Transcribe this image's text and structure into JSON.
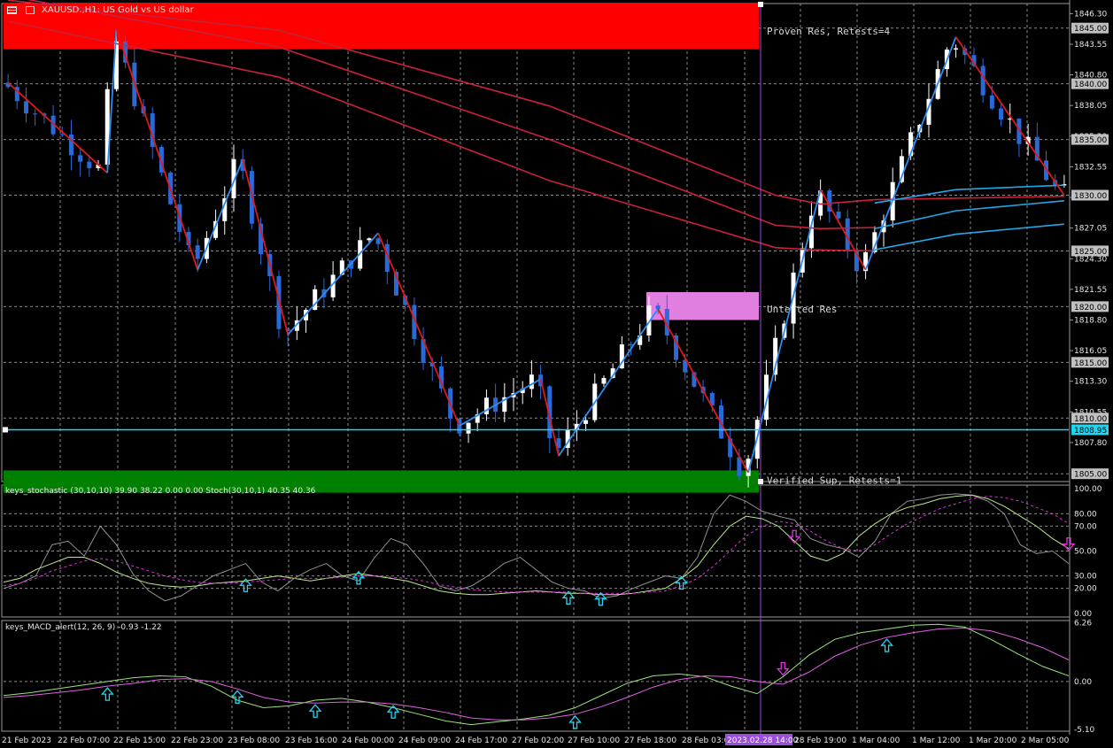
{
  "header": {
    "symbol_title": "XAUUSD.,H1: US Gold vs US dollar"
  },
  "chart_data": [
    {
      "type": "candlestick",
      "title": "XAUUSD.,H1: US Gold vs US dollar",
      "ylim": [
        1804.3,
        1847.2
      ],
      "y_ticks": [
        "1846.30",
        "1843.55",
        "1840.80",
        "1838.05",
        "1835.30",
        "1832.55",
        "1829.80",
        "1827.05",
        "1824.30",
        "1821.55",
        "1818.80",
        "1816.05",
        "1813.30",
        "1810.55",
        "1807.80"
      ],
      "price_tags": [
        {
          "label": "1845.00",
          "value": 1845.0,
          "color": "#c0c0c0"
        },
        {
          "label": "1840.00",
          "value": 1840.0,
          "color": "#c0c0c0"
        },
        {
          "label": "1835.00",
          "value": 1835.0,
          "color": "#c0c0c0"
        },
        {
          "label": "1830.00",
          "value": 1830.0,
          "color": "#c0c0c0"
        },
        {
          "label": "1825.00",
          "value": 1825.0,
          "color": "#c0c0c0"
        },
        {
          "label": "1820.00",
          "value": 1820.0,
          "color": "#c0c0c0"
        },
        {
          "label": "1815.00",
          "value": 1815.0,
          "color": "#c0c0c0"
        },
        {
          "label": "1810.00",
          "value": 1810.0,
          "color": "#c0c0c0"
        },
        {
          "label": "1808.95",
          "value": 1808.95,
          "color": "#22d4f0"
        },
        {
          "label": "1805.00",
          "value": 1805.0,
          "color": "#c0c0c0"
        }
      ],
      "current_price": 1808.95,
      "zones": [
        {
          "label": "Proven Res, Retests=4",
          "top": 1847.2,
          "bottom": 1843.1,
          "color": "#ff0000"
        },
        {
          "label": "Untested Res",
          "top": 1821.3,
          "bottom": 1818.8,
          "color": "#e07fe0"
        },
        {
          "label": "Verified Sup, Retests=1",
          "top": 1805.3,
          "bottom": 1803.3,
          "color": "#008000"
        }
      ],
      "zigzag": [
        {
          "x": 0,
          "y": 1840.1
        },
        {
          "x": 11,
          "y": 1832.0
        },
        {
          "x": 12,
          "y": 1844.9
        },
        {
          "x": 21,
          "y": 1823.3
        },
        {
          "x": 26,
          "y": 1833.2
        },
        {
          "x": 31,
          "y": 1817.5
        },
        {
          "x": 41,
          "y": 1826.6
        },
        {
          "x": 50,
          "y": 1809.3
        },
        {
          "x": 59,
          "y": 1813.5
        },
        {
          "x": 61,
          "y": 1806.6
        },
        {
          "x": 72,
          "y": 1819.8
        },
        {
          "x": 82,
          "y": 1805.1
        },
        {
          "x": 90,
          "y": 1830.5
        },
        {
          "x": 95,
          "y": 1823.3
        },
        {
          "x": 105,
          "y": 1844.2
        },
        {
          "x": 117,
          "y": 1830.0
        }
      ],
      "moving_averages": [
        {
          "name": "",
          "color": "#c8213c",
          "points": [
            [
              0,
              1847.5
            ],
            [
              30,
              1844.8
            ],
            [
              60,
              1838.0
            ],
            [
              85,
              1830.0
            ],
            [
              90,
              1829.2
            ],
            [
              96,
              1829.6
            ],
            [
              117,
              1829.9
            ]
          ]
        },
        {
          "name": "",
          "color": "#c8213c",
          "points": [
            [
              0,
              1847.9
            ],
            [
              30,
              1843.3
            ],
            [
              60,
              1835.0
            ],
            [
              85,
              1827.3
            ],
            [
              90,
              1827.0
            ],
            [
              96,
              1827.1
            ]
          ]
        },
        {
          "name": "",
          "color": "#c8213c",
          "points": [
            [
              0,
              1845.6
            ],
            [
              30,
              1840.6
            ],
            [
              60,
              1831.3
            ],
            [
              85,
              1825.3
            ],
            [
              89,
              1825.1
            ],
            [
              96,
              1825.0
            ]
          ]
        },
        {
          "name": "",
          "color": "#22a8e8",
          "points": [
            [
              96,
              1825.1
            ],
            [
              105,
              1826.5
            ],
            [
              117,
              1827.4
            ]
          ]
        },
        {
          "name": "",
          "color": "#22a8e8",
          "points": [
            [
              96,
              1827.0
            ],
            [
              105,
              1828.6
            ],
            [
              117,
              1829.5
            ]
          ]
        },
        {
          "name": "",
          "color": "#22a8e8",
          "points": [
            [
              96,
              1829.3
            ],
            [
              105,
              1830.5
            ],
            [
              117,
              1830.9
            ]
          ]
        }
      ],
      "x_labels": [
        "21 Feb 2023",
        "22 Feb 07:00",
        "22 Feb 15:00",
        "22 Feb 23:00",
        "23 Feb 08:00",
        "23 Feb 16:00",
        "24 Feb 00:00",
        "24 Feb 09:00",
        "24 Feb 17:00",
        "27 Feb 02:00",
        "27 Feb 10:00",
        "27 Feb 18:00",
        "28 Feb 03:00",
        "2023.02.28 14:00",
        "28 Feb 19:00",
        "1 Mar 04:00",
        "1 Mar 12:00",
        "1 Mar 20:00",
        "2 Mar 05:00"
      ]
    },
    {
      "type": "line",
      "title": "keys_stochastic (30,10,10) 39.90 38.22 0.00 0.00 Stoch(30,10,1) 40.35 40.36",
      "ylim": [
        -3,
        103
      ],
      "y_ticks": [
        "100.00",
        "80.00",
        "70.00",
        "50.00",
        "30.00",
        "20.00",
        "0.00"
      ],
      "series": [
        {
          "name": "",
          "color": "#909090",
          "values": [
            20,
            24,
            30,
            55,
            58,
            46,
            70,
            55,
            32,
            18,
            10,
            14,
            22,
            30,
            35,
            40,
            25,
            18,
            28,
            35,
            40,
            30,
            26,
            45,
            60,
            55,
            40,
            22,
            18,
            22,
            30,
            40,
            45,
            35,
            25,
            20,
            18,
            12,
            14,
            20,
            25,
            30,
            28,
            45,
            80,
            95,
            90,
            82,
            78,
            75,
            60,
            55,
            52,
            45,
            58,
            80,
            90,
            92,
            95,
            96,
            95,
            90,
            80,
            55,
            48,
            50,
            40
          ]
        },
        {
          "name": "",
          "color": "#b9e88a",
          "values": [
            25,
            28,
            35,
            40,
            45,
            45,
            40,
            33,
            28,
            24,
            22,
            21,
            22,
            24,
            25,
            26,
            28,
            30,
            28,
            26,
            28,
            30,
            32,
            30,
            28,
            26,
            22,
            18,
            16,
            15,
            15,
            16,
            17,
            18,
            17,
            16,
            16,
            15,
            15,
            16,
            18,
            20,
            28,
            38,
            55,
            70,
            78,
            76,
            70,
            58,
            46,
            42,
            48,
            62,
            72,
            80,
            85,
            88,
            92,
            94,
            95,
            92,
            86,
            78,
            70,
            60,
            52
          ]
        },
        {
          "name": "",
          "color": "#e030e0",
          "dashed": true,
          "values": [
            22,
            24,
            28,
            34,
            38,
            42,
            44,
            42,
            38,
            34,
            30,
            27,
            25,
            24,
            24,
            25,
            26,
            27,
            28,
            28,
            28,
            29,
            30,
            30,
            29,
            28,
            26,
            23,
            21,
            19,
            18,
            17,
            17,
            17,
            17,
            17,
            16,
            16,
            16,
            16,
            17,
            18,
            22,
            28,
            38,
            50,
            62,
            70,
            74,
            72,
            66,
            58,
            52,
            50,
            55,
            64,
            72,
            78,
            84,
            88,
            92,
            94,
            93,
            90,
            85,
            80,
            72
          ]
        }
      ],
      "arrows_up_x": [
        15,
        22,
        35,
        37,
        42
      ],
      "arrows_down_x": [
        49,
        66
      ]
    },
    {
      "type": "line",
      "title": "keys_MACD_alert(12, 26, 9) -0.93 -1.22",
      "ylim": [
        -5.3,
        6.5
      ],
      "y_ticks": [
        "6.26",
        "0.00",
        "-5.10"
      ],
      "series": [
        {
          "name": "",
          "color": "#9be27a",
          "values": [
            -1.5,
            -1.2,
            -0.8,
            -0.4,
            0.0,
            0.4,
            0.6,
            0.5,
            -0.5,
            -2.0,
            -2.8,
            -2.6,
            -2.0,
            -1.8,
            -2.2,
            -2.8,
            -3.5,
            -4.2,
            -4.6,
            -4.3,
            -4.0,
            -3.6,
            -2.8,
            -1.5,
            -0.2,
            0.6,
            0.8,
            0.5,
            -0.5,
            -1.3,
            0.5,
            2.8,
            4.5,
            5.2,
            5.6,
            6.0,
            6.1,
            5.8,
            4.5,
            3.0,
            1.6,
            0.6
          ]
        },
        {
          "name": "",
          "color": "#e060e0",
          "values": [
            -1.7,
            -1.5,
            -1.2,
            -0.9,
            -0.5,
            -0.2,
            0.2,
            0.3,
            0.0,
            -0.8,
            -1.7,
            -2.2,
            -2.3,
            -2.2,
            -2.2,
            -2.4,
            -2.8,
            -3.3,
            -3.9,
            -4.1,
            -4.1,
            -3.9,
            -3.5,
            -2.7,
            -1.7,
            -0.6,
            0.2,
            0.6,
            0.5,
            0.0,
            -0.3,
            1.0,
            2.7,
            3.9,
            4.7,
            5.2,
            5.6,
            5.7,
            5.4,
            4.6,
            3.6,
            2.3
          ]
        }
      ],
      "arrows_up_x": [
        7,
        15,
        20,
        24,
        36,
        54
      ],
      "arrows_down_x": [
        49,
        67
      ]
    }
  ],
  "panels": {
    "stoch_title": "keys_stochastic (30,10,10) 39.90 38.22 0.00 0.00 Stoch(30,10,1) 40.35 40.36",
    "macd_title": "keys_MACD_alert(12, 26, 9) -0.93 -1.22"
  },
  "colors": {
    "background": "#000000",
    "grid": "#b8b8b8",
    "bull_candle": "#ffffff",
    "bear_candle": "#2a6ad8",
    "zigzag_up": "#2a8cf0",
    "zigzag_down": "#e01818",
    "current_line": "#22d4f0",
    "separator": "#9b4ddb"
  }
}
